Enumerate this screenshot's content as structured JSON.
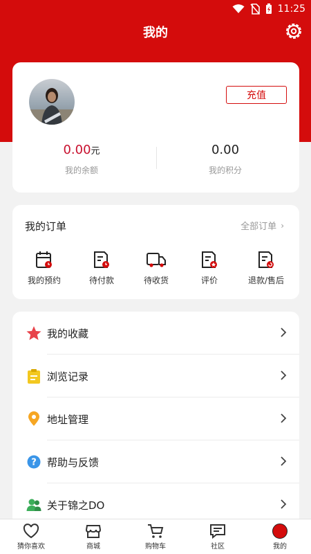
{
  "status_bar": {
    "time": "11:25"
  },
  "header": {
    "title": "我的"
  },
  "profile": {
    "recharge_label": "充值",
    "balance_value": "0.00",
    "balance_unit": "元",
    "balance_label": "我的余额",
    "points_value": "0.00",
    "points_label": "我的积分"
  },
  "orders": {
    "title": "我的订单",
    "all_label": "全部订单",
    "items": [
      {
        "label": "我的预约",
        "icon": "calendar-icon"
      },
      {
        "label": "待付款",
        "icon": "pending-payment-icon"
      },
      {
        "label": "待收货",
        "icon": "delivery-truck-icon"
      },
      {
        "label": "评价",
        "icon": "review-icon"
      },
      {
        "label": "退款/售后",
        "icon": "refund-icon"
      }
    ]
  },
  "menu": {
    "items": [
      {
        "label": "我的收藏",
        "icon": "star-icon"
      },
      {
        "label": "浏览记录",
        "icon": "clipboard-icon"
      },
      {
        "label": "地址管理",
        "icon": "location-pin-icon"
      },
      {
        "label": "帮助与反馈",
        "icon": "help-icon"
      },
      {
        "label": "关于锦之DO",
        "icon": "users-icon"
      }
    ]
  },
  "bottom_nav": {
    "items": [
      {
        "label": "猜你喜欢",
        "icon": "heart-icon"
      },
      {
        "label": "商城",
        "icon": "shop-icon"
      },
      {
        "label": "购物车",
        "icon": "cart-icon"
      },
      {
        "label": "社区",
        "icon": "chat-icon"
      },
      {
        "label": "我的",
        "icon": "profile-dot-icon"
      }
    ]
  },
  "colors": {
    "brand_red": "#d40c0c",
    "muted": "#999999"
  }
}
